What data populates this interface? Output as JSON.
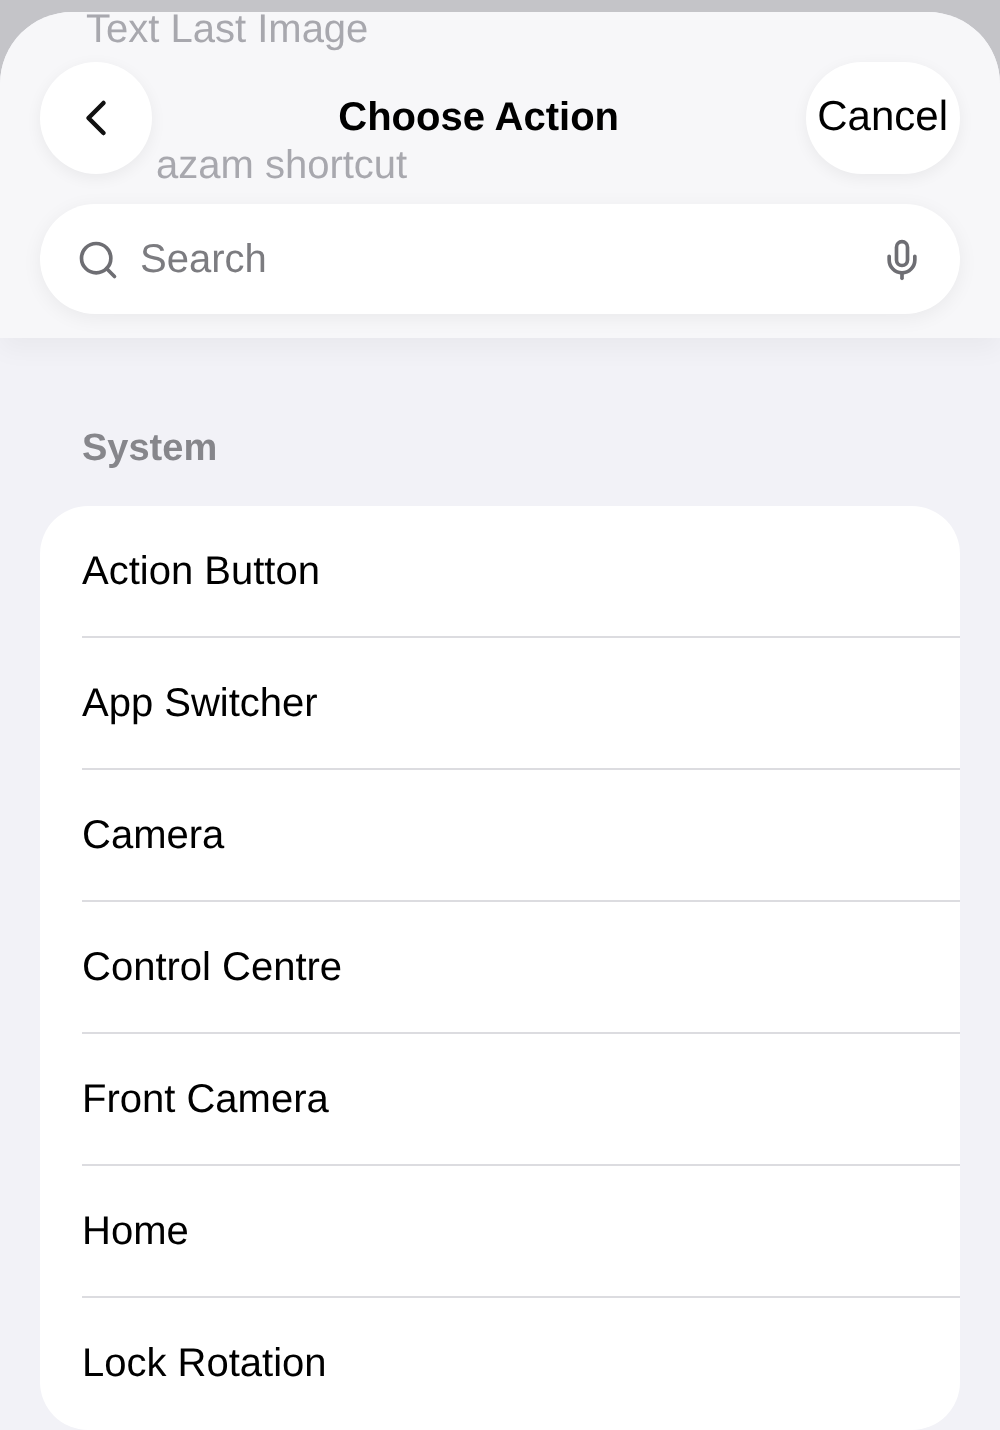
{
  "background_items": [
    "Text Last Image",
    "azam shortcut"
  ],
  "header": {
    "title": "Choose Action",
    "cancel": "Cancel"
  },
  "search": {
    "placeholder": "Search"
  },
  "section": {
    "title": "System",
    "items": [
      "Action Button",
      "App Switcher",
      "Camera",
      "Control Centre",
      "Front Camera",
      "Home",
      "Lock Rotation"
    ]
  }
}
